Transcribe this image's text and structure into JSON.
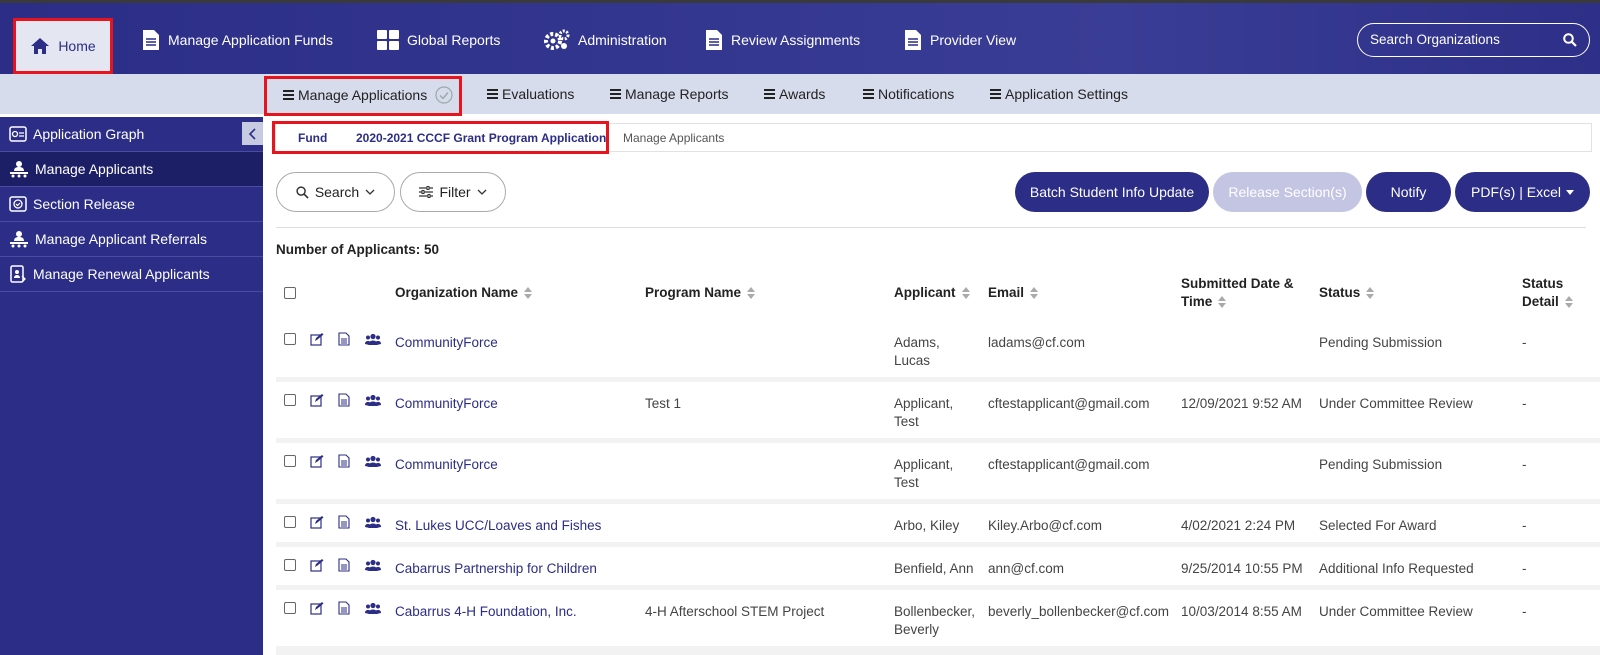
{
  "topnav": {
    "home": "Home",
    "items": [
      "Manage Application Funds",
      "Global Reports",
      "Administration",
      "Review Assignments",
      "Provider View"
    ],
    "search_placeholder": "Search Organizations"
  },
  "subnav": {
    "items": [
      "Manage Applications",
      "Evaluations",
      "Manage Reports",
      "Awards",
      "Notifications",
      "Application Settings"
    ]
  },
  "sidebar": {
    "items": [
      "Application Graph",
      "Manage Applicants",
      "Section Release",
      "Manage Applicant Referrals",
      "Manage Renewal Applicants"
    ]
  },
  "breadcrumb": {
    "fund": "Fund",
    "program": "2020-2021 CCCF Grant Program Application",
    "current": "Manage Applicants"
  },
  "toolbar": {
    "search": "Search",
    "filter": "Filter",
    "batch": "Batch Student Info Update",
    "release": "Release Section(s)",
    "notify": "Notify",
    "pdf": "PDF(s) | Excel"
  },
  "count_label": "Number of Applicants: 50",
  "table": {
    "headers": {
      "org": "Organization Name",
      "program": "Program Name",
      "applicant": "Applicant",
      "email": "Email",
      "submitted1": "Submitted Date &",
      "submitted2": "Time",
      "status": "Status",
      "detail1": "Status",
      "detail2": "Detail"
    },
    "rows": [
      {
        "org": "CommunityForce",
        "program": "",
        "applicant1": "Adams,",
        "applicant2": "Lucas",
        "email": "ladams@cf.com",
        "date": "",
        "status": "Pending Submission",
        "detail": "-"
      },
      {
        "org": "CommunityForce",
        "program": "Test 1",
        "applicant1": "Applicant,",
        "applicant2": "Test",
        "email": "cftestapplicant@gmail.com",
        "date": "12/09/2021 9:52 AM",
        "status": "Under Committee Review",
        "detail": "-"
      },
      {
        "org": "CommunityForce",
        "program": "",
        "applicant1": "Applicant,",
        "applicant2": "Test",
        "email": "cftestapplicant@gmail.com",
        "date": "",
        "status": "Pending Submission",
        "detail": "-"
      },
      {
        "org": "St. Lukes UCC/Loaves and Fishes",
        "program": "",
        "applicant1": "Arbo, Kiley",
        "applicant2": "",
        "email": "Kiley.Arbo@cf.com",
        "date": "4/02/2021 2:24 PM",
        "status": "Selected For Award",
        "detail": "-"
      },
      {
        "org": "Cabarrus Partnership for Children",
        "program": "",
        "applicant1": "Benfield, Ann",
        "applicant2": "",
        "email": "ann@cf.com",
        "date": "9/25/2014 10:55 PM",
        "status": "Additional Info Requested",
        "detail": "-"
      },
      {
        "org": "Cabarrus 4-H Foundation, Inc.",
        "program": "4-H Afterschool STEM Project",
        "applicant1": "Bollenbecker,",
        "applicant2": "Beverly",
        "email": "beverly_bollenbecker@cf.com",
        "date": "10/03/2014 8:55 AM",
        "status": "Under Committee Review",
        "detail": "-"
      }
    ]
  }
}
